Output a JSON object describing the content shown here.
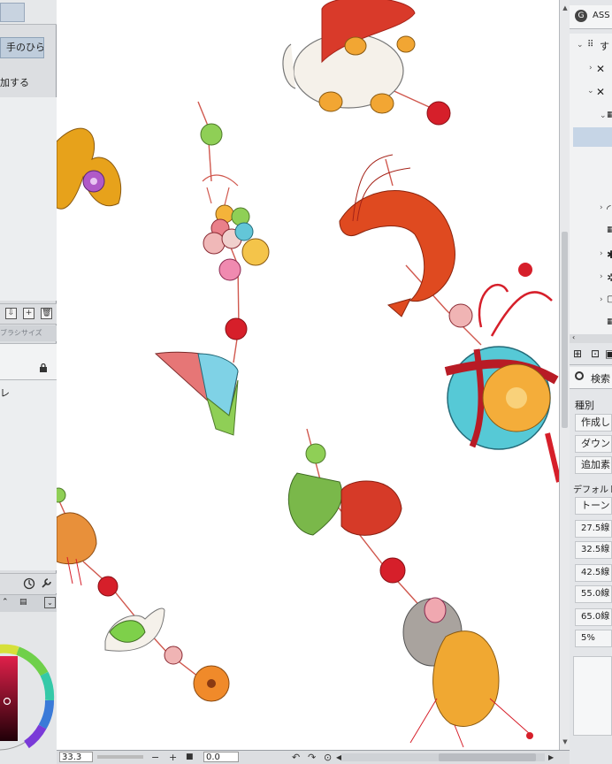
{
  "left_panel": {
    "palm_button_label": "手のひら",
    "add_text": "加する",
    "brush_tab_label": "ブラシサイズ",
    "stray_text": "レ"
  },
  "status_bar": {
    "zoom": "33.3",
    "angle": "0.0",
    "minus": "−",
    "plus": "+",
    "stop": "■"
  },
  "right_panel": {
    "header_title": "ASS",
    "tree_items": [
      "す",
      "",
      "",
      "",
      "",
      "",
      "",
      "",
      "",
      ""
    ],
    "search_label": "検索",
    "kind_label": "種別",
    "filter_items": [
      "作成し",
      "ダウンロ",
      "追加素"
    ],
    "default_label": "デフォルト",
    "tone_label": "トーン",
    "line_items": [
      "27.5線",
      "32.5線",
      "42.5線",
      "55.0線",
      "65.0線",
      "5%"
    ]
  },
  "colors": {
    "selection_blue": "#c6d5e6",
    "canvas_bg": "#ffffff",
    "panel_bg": "#dcdee1"
  }
}
